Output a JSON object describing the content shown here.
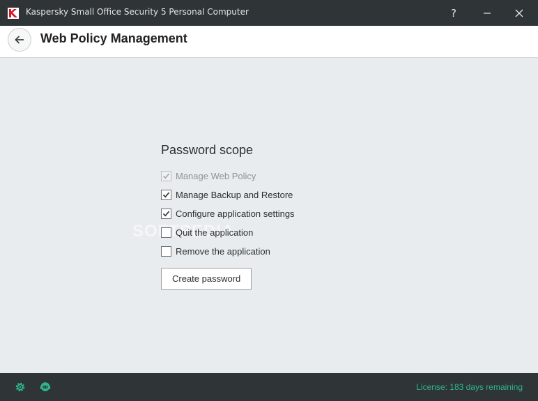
{
  "window": {
    "title": "Kaspersky Small Office Security 5 Personal Computer",
    "controls": {
      "help": "?",
      "minimize": "minimize-icon",
      "close": "close-icon"
    }
  },
  "header": {
    "back_icon": "arrow-left-icon",
    "title": "Web Policy Management"
  },
  "main": {
    "section_title": "Password scope",
    "options": [
      {
        "label": "Manage Web Policy",
        "checked": true,
        "disabled": true
      },
      {
        "label": "Manage Backup and Restore",
        "checked": true,
        "disabled": false
      },
      {
        "label": "Configure application settings",
        "checked": true,
        "disabled": false
      },
      {
        "label": "Quit the application",
        "checked": false,
        "disabled": false
      },
      {
        "label": "Remove the application",
        "checked": false,
        "disabled": false
      }
    ],
    "create_button": "Create password",
    "watermark": "SOFTPEDIA"
  },
  "footer": {
    "settings_icon": "gear-icon",
    "support_icon": "support-agent-icon",
    "license": "License: 183 days remaining"
  },
  "colors": {
    "titlebar": "#2f3437",
    "background": "#e8ecee",
    "accent_green": "#2fb58e"
  }
}
